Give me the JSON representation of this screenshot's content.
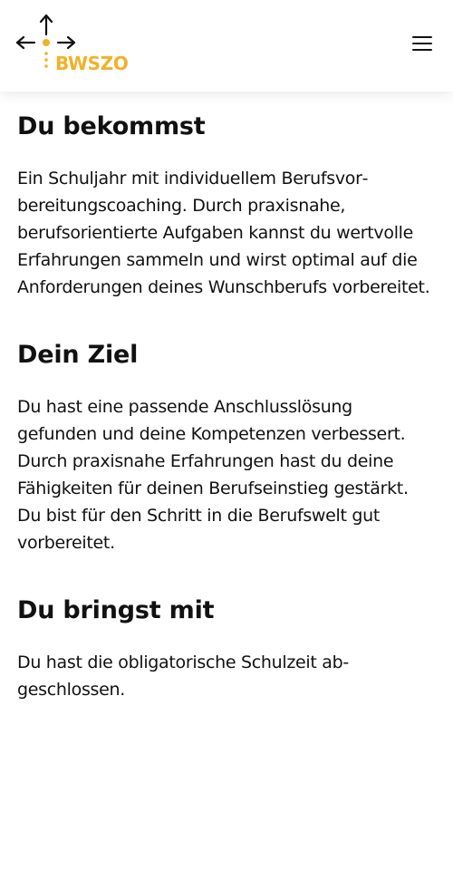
{
  "header": {
    "logo_text": "BWSZO",
    "brand_color": "#f2b12b",
    "menu_icon": "hamburger-menu-icon"
  },
  "sections": [
    {
      "heading": "Du bekommst",
      "body": "Ein Schuljahr mit individuellem Berufsvor­bereitungscoaching. Durch praxisnahe, berufsorientierte Aufgaben kannst du wertvolle Erfahrungen sammeln und wirst optimal auf die Anforderungen deines Wunschberufs vorbereitet."
    },
    {
      "heading": "Dein Ziel",
      "body": "Du hast eine passende Anschlusslösung gefunden und deine Kompetenzen ver­bessert. Durch praxisnahe Erfahrungen hast du deine Fähigkeiten für deinen Be­rufseinstieg gestärkt. Du bist für den Schritt in die Berufswelt gut vorbereitet."
    },
    {
      "heading": "Du bringst mit",
      "body": "Du hast die obligatorische Schulzeit ab­geschlossen."
    }
  ]
}
